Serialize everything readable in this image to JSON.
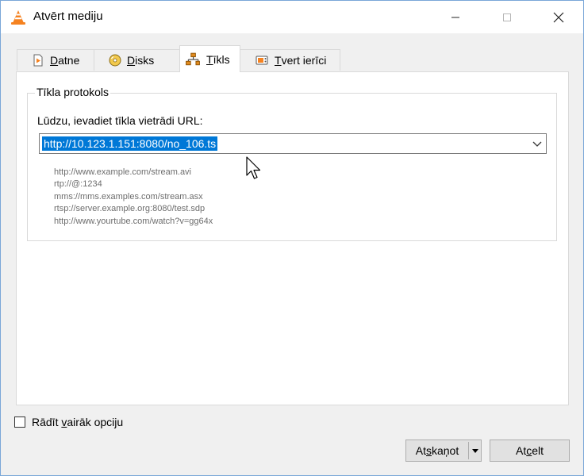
{
  "window": {
    "title": "Atvērt mediju",
    "accent": "#0078d7"
  },
  "tabs": [
    {
      "pre": "",
      "key": "D",
      "post": "atne",
      "icon": "play-file-icon"
    },
    {
      "pre": "",
      "key": "D",
      "post": "isks",
      "icon": "disc-icon"
    },
    {
      "pre": "",
      "key": "T",
      "post": "īkls",
      "icon": "network-icon"
    },
    {
      "pre": "",
      "key": "T",
      "post": "vert ierīci",
      "icon": "capture-device-icon"
    }
  ],
  "network": {
    "group_title": "Tīkla protokols",
    "url_label": "Lūdzu, ievadiet tīkla vietrādi URL:",
    "url_value": "http://10.123.1.151:8080/no_106.ts",
    "examples": [
      "http://www.example.com/stream.avi",
      "rtp://@:1234",
      "mms://mms.examples.com/stream.asx",
      "rtsp://server.example.org:8080/test.sdp",
      "http://www.yourtube.com/watch?v=gg64x"
    ]
  },
  "options": {
    "show_more_pre": "Rādīt ",
    "show_more_key": "v",
    "show_more_post": "airāk opciju",
    "checked": false
  },
  "buttons": {
    "play_pre": "At",
    "play_key": "s",
    "play_post": "kaņot",
    "cancel_pre": "At",
    "cancel_key": "c",
    "cancel_post": "elt"
  }
}
